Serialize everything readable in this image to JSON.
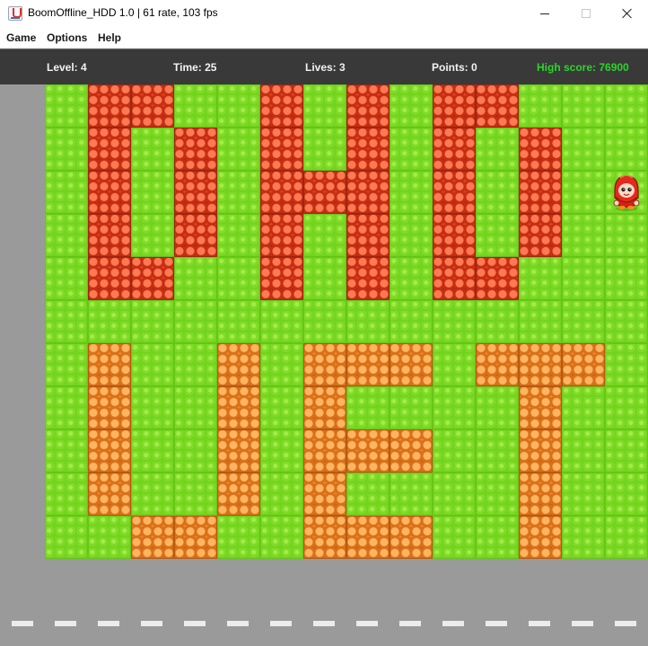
{
  "window": {
    "title": "BoomOffline_HDD 1.0 | 61 rate, 103 fps",
    "icon": "java-app-icon"
  },
  "menu": {
    "items": [
      "Game",
      "Options",
      "Help"
    ]
  },
  "hud": {
    "level": "Level: 4",
    "time": "Time: 25",
    "lives": "Lives: 3",
    "points": "Points: 0",
    "high_score": "High score: 76900",
    "high_score_color": "#2ed32e",
    "text_color": "#f2f2f2"
  },
  "board": {
    "columns": 14,
    "rows": 11,
    "legend": {
      ".": "grass",
      "R": "red-brick",
      "O": "orange-brick",
      "P": "player"
    },
    "layout": [
      ".RR..R.R.RR...",
      ".R.R.R.R.R.R..",
      ".R.R.RRR.R.R.P",
      ".R.R.R.R.R.R..",
      ".RR..R.R.RR...",
      "..............",
      ".O..O.OOO.OOO.",
      ".O..O.O....O..",
      ".O..O.OOO..O..",
      ".O..O.O....O..",
      "..OO..OOO..O.."
    ],
    "colors": {
      "grass": "#73d41e",
      "red_brick": "#e5411f",
      "orange_brick": "#f08a22",
      "border": "#9a9a9a",
      "road_dash": "#ececec"
    }
  },
  "player": {
    "character": "red-hooded-bomber",
    "row": 2,
    "col": 13
  },
  "road": {
    "dash_count": 15
  }
}
